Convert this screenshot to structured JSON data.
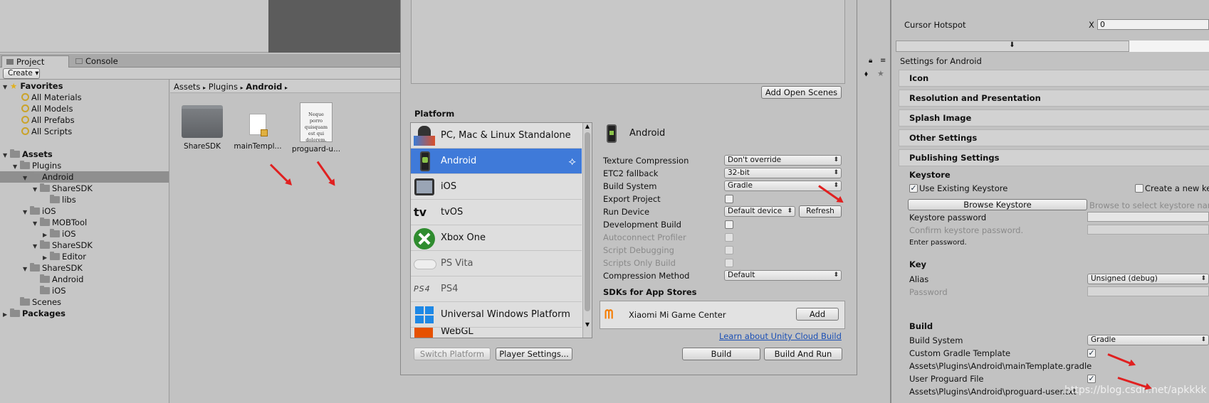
{
  "project_panel": {
    "tab_project": "Project",
    "tab_console": "Console",
    "create_label": "Create",
    "favorites_label": "Favorites",
    "favorites": [
      "All Materials",
      "All Models",
      "All Prefabs",
      "All Scripts"
    ],
    "assets_label": "Assets",
    "tree": {
      "plugins": "Plugins",
      "android": "Android",
      "sharesdk": "ShareSDK",
      "libs": "libs",
      "ios": "iOS",
      "mobtool": "MOBTool",
      "ios2": "iOS",
      "sharesdk2": "ShareSDK",
      "editor": "Editor",
      "sharesdk3": "ShareSDK",
      "android2": "Android",
      "ios3": "iOS",
      "scenes": "Scenes"
    },
    "packages_label": "Packages",
    "breadcrumb": [
      "Assets",
      "Plugins",
      "Android"
    ],
    "files": [
      {
        "name": "ShareSDK",
        "type": "folder"
      },
      {
        "name": "mainTempl...",
        "type": "file"
      },
      {
        "name": "proguard-u...",
        "type": "doc",
        "preview": "Neque porro quisquam est qui dolorem."
      }
    ]
  },
  "build_settings": {
    "add_open_scenes": "Add Open Scenes",
    "platform_label": "Platform",
    "platforms": [
      "PC, Mac & Linux Standalone",
      "Android",
      "iOS",
      "tvOS",
      "Xbox One",
      "PS Vita",
      "PS4",
      "Universal Windows Platform",
      "WebGL"
    ],
    "tvos_glyph": "tv",
    "selected_platform": "Android",
    "rows": {
      "texture_compression": {
        "label": "Texture Compression",
        "value": "Don't override"
      },
      "etc2_fallback": {
        "label": "ETC2 fallback",
        "value": "32-bit"
      },
      "build_system": {
        "label": "Build System",
        "value": "Gradle"
      },
      "export_project": {
        "label": "Export Project"
      },
      "run_device": {
        "label": "Run Device",
        "value": "Default device",
        "refresh": "Refresh"
      },
      "development_build": {
        "label": "Development Build"
      },
      "autoconnect_profiler": {
        "label": "Autoconnect Profiler"
      },
      "script_debugging": {
        "label": "Script Debugging"
      },
      "scripts_only_build": {
        "label": "Scripts Only Build"
      },
      "compression_method": {
        "label": "Compression Method",
        "value": "Default"
      }
    },
    "sdks_label": "SDKs for App Stores",
    "sdk_name": "Xiaomi Mi Game Center",
    "sdk_add": "Add",
    "cloud_link": "Learn about Unity Cloud Build",
    "switch_platform": "Switch Platform",
    "player_settings": "Player Settings...",
    "build": "Build",
    "build_and_run": "Build And Run"
  },
  "inspector": {
    "cursor_hotspot": "Cursor Hotspot",
    "x_label": "X",
    "x_value": "0",
    "settings_for": "Settings for Android",
    "sections": [
      "Icon",
      "Resolution and Presentation",
      "Splash Image",
      "Other Settings",
      "Publishing Settings"
    ],
    "keystore_label": "Keystore",
    "use_existing_keystore": "Use Existing Keystore",
    "create_new_keystore": "Create a new keystore",
    "browse_keystore": "Browse Keystore",
    "browse_placeholder": "Browse to select keystore name",
    "keystore_password": "Keystore password",
    "confirm_keystore_password": "Confirm keystore password.",
    "enter_password": "Enter password.",
    "key_label": "Key",
    "alias_label": "Alias",
    "alias_value": "Unsigned (debug)",
    "password_label": "Password",
    "build_label": "Build",
    "build_system_label": "Build System",
    "build_system_value": "Gradle",
    "custom_gradle_template": "Custom Gradle Template",
    "gradle_path": "Assets\\Plugins\\Android\\mainTemplate.gradle",
    "user_proguard_file": "User Proguard File",
    "proguard_path": "Assets\\Plugins\\Android\\proguard-user.txt",
    "watermark": "https://blog.csdn.net/apkkkk"
  }
}
